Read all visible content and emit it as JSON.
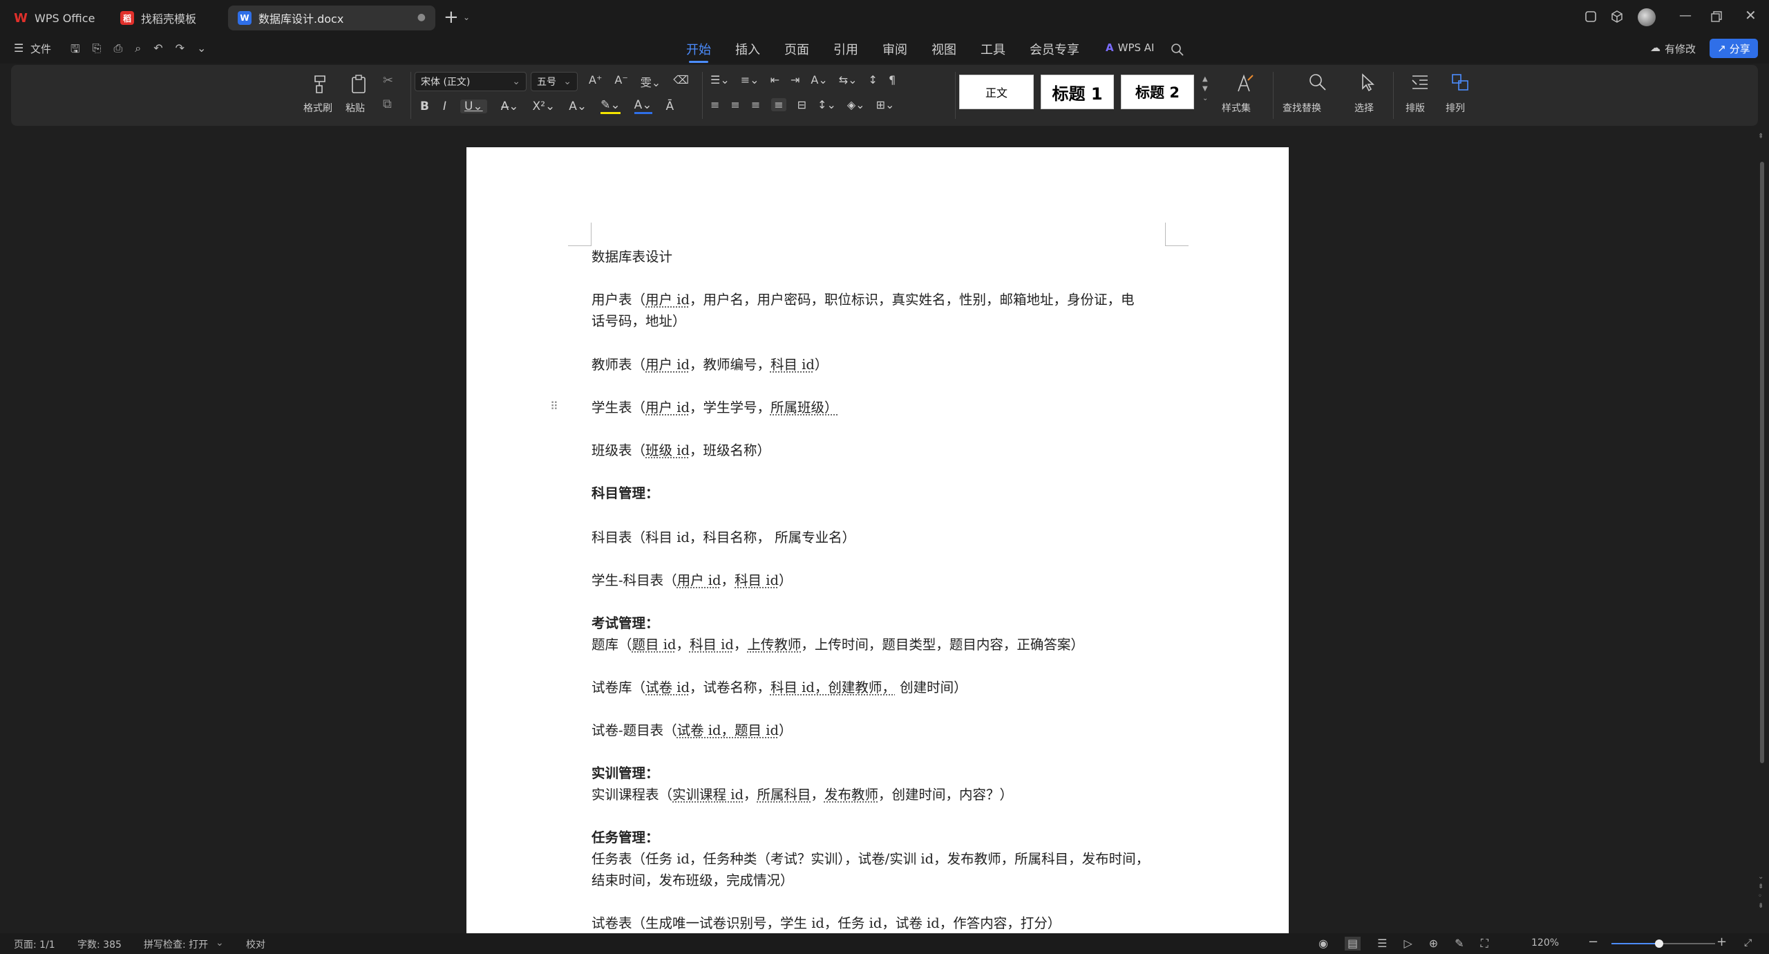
{
  "titlebar": {
    "tabs": [
      {
        "label": "WPS Office"
      },
      {
        "label": "找稻壳模板"
      },
      {
        "label": "数据库设计.docx"
      }
    ]
  },
  "menubar": {
    "file_label": "文件",
    "tabs": [
      "开始",
      "插入",
      "页面",
      "引用",
      "审阅",
      "视图",
      "工具",
      "会员专享"
    ],
    "active_tab": "开始",
    "wps_ai": "WPS AI",
    "modify_label": "有修改",
    "share_label": "分享"
  },
  "ribbon": {
    "format_painter": "格式刷",
    "paste": "粘贴",
    "font_name": "宋体 (正文)",
    "font_size": "五号",
    "styles": {
      "normal": "正文",
      "h1": "标题 1",
      "h2": "标题 2"
    },
    "style_set": "样式集",
    "find_replace": "查找替换",
    "select": "选择",
    "layout": "排版",
    "arrange": "排列"
  },
  "document": {
    "title": "数据库表设计",
    "paragraphs": [
      {
        "pre": "用户表（",
        "u1": "用户 id",
        "post": "，用户名，用户密码，职位标识，真实姓名，性别，邮箱地址，身份证，电"
      },
      {
        "text": "话号码，地址）"
      },
      {
        "pre": "教师表（",
        "u1": "用户 id",
        "mid": "，教师编号，",
        "u2": "科目 id",
        "post": "）"
      },
      {
        "pre": "学生表（",
        "u1": "用户 id",
        "mid": "，学生学号，",
        "u2": "所属班级）",
        "post": ""
      },
      {
        "pre": "班级表（",
        "u1": "班级 id",
        "post": "，班级名称）"
      },
      {
        "heading": "科目管理："
      },
      {
        "text": "科目表（科目 id，科目名称，  所属专业名）"
      },
      {
        "pre": "学生-科目表（",
        "u1": "用户 id",
        "mid": "，",
        "u2": "科目 id",
        "post": "）"
      },
      {
        "heading": "考试管理："
      },
      {
        "pre": "题库（",
        "u1": "题目 id",
        "mid": "，",
        "u2": "科目 id",
        "mid2": "，",
        "u3": "上传教师",
        "post": "，上传时间，题目类型，题目内容，正确答案）"
      },
      {
        "pre": "试卷库（",
        "u1": "试卷 id",
        "mid": "，试卷名称，",
        "u2": "科目 id，创建教师，",
        "post": "  创建时间）"
      },
      {
        "pre": "试卷-题目表（",
        "u1": "试卷 id，题目 id",
        "post": "）"
      },
      {
        "heading": "实训管理："
      },
      {
        "pre": "实训课程表（",
        "u1": "实训课程 id",
        "mid": "，",
        "u2": "所属科目",
        "mid2": "，",
        "u3": "发布教师",
        "post": "，创建时间，内容？）"
      },
      {
        "heading": "任务管理："
      },
      {
        "text": "任务表（任务 id，任务种类（考试？实训），试卷/实训 id，发布教师，所属科目，发布时间，"
      },
      {
        "text": "结束时间，发布班级，完成情况）"
      },
      {
        "text": "试卷表（生成唯一试卷识别号，学生 id，任务 id，试卷 id，作答内容，打分）"
      }
    ]
  },
  "statusbar": {
    "page": "页面: 1/1",
    "words": "字数: 385",
    "spell": "拼写检查: 打开",
    "proof": "校对",
    "zoom": "120%"
  },
  "colors": {
    "accent": "#4c8dff",
    "share_bg": "#2f6fe8",
    "wps_red": "#e0302b"
  }
}
